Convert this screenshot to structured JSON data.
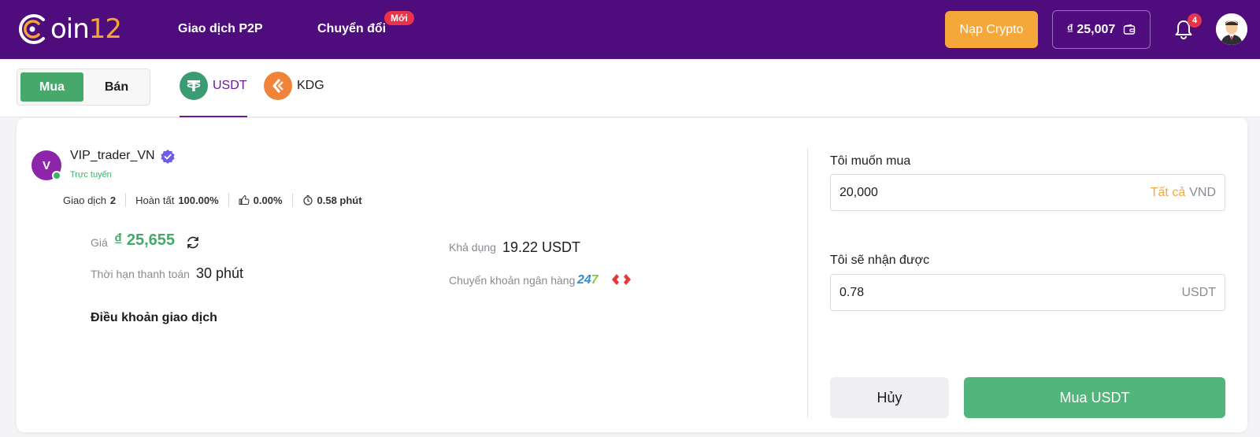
{
  "header": {
    "logo_main": "oin",
    "logo_num": "12",
    "nav": [
      {
        "label": "Giao dịch P2P"
      },
      {
        "label": "Chuyển đổi",
        "badge": "Mới"
      }
    ],
    "deposit_label": "Nạp Crypto",
    "wallet_balance": "₫ 25,007",
    "notification_count": "4",
    "icons": [
      "bell-icon",
      "wallet-icon",
      "user-avatar"
    ],
    "colors": {
      "bar": "#4e0c7c",
      "accent": "#f5a73a",
      "badge": "#e8334a"
    }
  },
  "subnav": {
    "toggle": {
      "buy": "Mua",
      "sell": "Bán",
      "active": "buy"
    },
    "coins": [
      {
        "label": "USDT",
        "active": true,
        "icon": "tether-icon"
      },
      {
        "label": "KDG",
        "active": false,
        "icon": "kdg-icon"
      }
    ]
  },
  "trader": {
    "avatar_letter": "V",
    "name": "VIP_trader_VN",
    "status": "Trực tuyến",
    "stats": {
      "trades_label": "Giao dịch",
      "trades_value": "2",
      "completion_label": "Hoàn tất",
      "completion_value": "100.00%",
      "rating_value": "0.00%",
      "time_value": "0.58 phút"
    }
  },
  "offer": {
    "price_label": "Giá",
    "price_value": "₫ 25,655",
    "deadline_label": "Thời hạn thanh toán",
    "deadline_value": "30 phút",
    "terms_label": "Điều khoản giao dịch",
    "available_label": "Khả dụng",
    "available_value": "19.22 USDT",
    "bank_label": "Chuyển khoản ngân hàng",
    "bank_logo_a": "24",
    "bank_logo_b": "7"
  },
  "form": {
    "buy_label": "Tôi muốn mua",
    "buy_value": "20,000",
    "all_link": "Tất cả",
    "buy_unit": "VND",
    "receive_label": "Tôi sẽ nhận được",
    "receive_value": "0.78",
    "receive_unit": "USDT",
    "cancel_label": "Hủy",
    "submit_label": "Mua USDT"
  }
}
